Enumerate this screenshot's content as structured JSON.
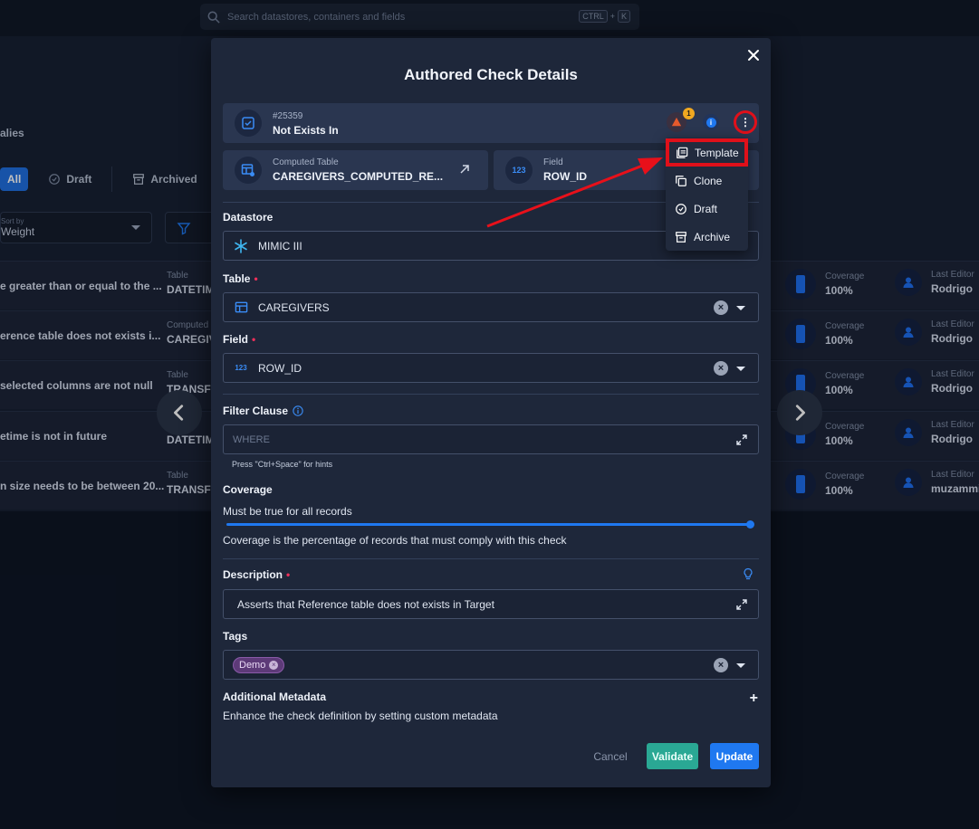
{
  "search": {
    "placeholder": "Search datastores, containers and fields",
    "kbd_ctrl": "CTRL",
    "kbd_plus": "+",
    "kbd_k": "K"
  },
  "background": {
    "section_title": "alies",
    "tabs": [
      {
        "label": "All"
      },
      {
        "label": "Draft"
      },
      {
        "label": "Archived"
      }
    ],
    "sort_label": "Sort by",
    "sort_value": "Weight",
    "rows": [
      {
        "name": "e greater than or equal to the ...",
        "type_label": "Table",
        "type_value": "DATETIME",
        "coverage_label": "Coverage",
        "coverage_value": "100%",
        "editor_label": "Last Editor",
        "editor_value": "Rodrigo"
      },
      {
        "name": "erence table does not exists i...",
        "type_label": "Computed",
        "type_value": "CAREGIV",
        "coverage_label": "Coverage",
        "coverage_value": "100%",
        "editor_label": "Last Editor",
        "editor_value": "Rodrigo"
      },
      {
        "name": "selected columns are not null",
        "type_label": "Table",
        "type_value": "TRANSFE",
        "coverage_label": "Coverage",
        "coverage_value": "100%",
        "editor_label": "Last Editor",
        "editor_value": "Rodrigo"
      },
      {
        "name": "etime is not in future",
        "type_label": "Table",
        "type_value": "DATETIM",
        "coverage_label": "Coverage",
        "coverage_value": "100%",
        "editor_label": "Last Editor",
        "editor_value": "Rodrigo"
      },
      {
        "name": "n size needs to be between 20...",
        "type_label": "Table",
        "type_value": "TRANSFE",
        "coverage_label": "Coverage",
        "coverage_value": "100%",
        "editor_label": "Last Editor",
        "editor_value": "muzammi"
      }
    ]
  },
  "modal": {
    "title": "Authored Check Details",
    "check": {
      "id": "#25359",
      "name": "Not Exists In",
      "warning_count": "1",
      "info_glyph": "i"
    },
    "computed_table": {
      "label": "Computed Table",
      "value": "CAREGIVERS_COMPUTED_RE..."
    },
    "field_card": {
      "label": "Field",
      "value": "ROW_ID",
      "icon_text": "123"
    },
    "datastore": {
      "label": "Datastore",
      "value": "MIMIC III"
    },
    "table": {
      "label": "Table",
      "value": "CAREGIVERS"
    },
    "field": {
      "label": "Field",
      "value": "ROW_ID",
      "icon_text": "123"
    },
    "filter": {
      "label": "Filter Clause",
      "placeholder": "WHERE",
      "hint": "Press \"Ctrl+Space\" for hints"
    },
    "coverage": {
      "label": "Coverage",
      "text": "Must be true for all records",
      "description": "Coverage is the percentage of records that must comply with this check",
      "value": 1.0
    },
    "description": {
      "label": "Description",
      "value": "Asserts that Reference table does not exists in Target"
    },
    "tags": {
      "label": "Tags",
      "items": [
        "Demo"
      ]
    },
    "metadata": {
      "label": "Additional Metadata",
      "text": "Enhance the check definition by setting custom metadata"
    },
    "buttons": {
      "cancel": "Cancel",
      "validate": "Validate",
      "update": "Update"
    }
  },
  "menu": {
    "items": [
      {
        "label": "Template",
        "icon": "template-icon"
      },
      {
        "label": "Clone",
        "icon": "clone-icon"
      },
      {
        "label": "Draft",
        "icon": "draft-icon"
      },
      {
        "label": "Archive",
        "icon": "archive-icon"
      }
    ]
  },
  "colors": {
    "accent": "#1f78f0",
    "validate": "#2aa894",
    "highlight": "#e0101a",
    "tag": "#5d3a78"
  }
}
